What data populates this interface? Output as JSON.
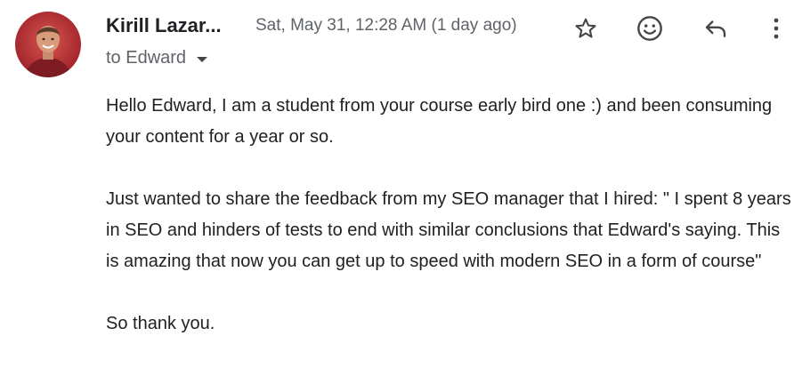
{
  "email": {
    "sender": {
      "name": "Kirill Lazar...",
      "avatar_alt": "avatar"
    },
    "date": "Sat, May 31, 12:28 AM (1 day ago)",
    "recipient_label": "to Edward",
    "actions": {
      "star": "star-icon",
      "emoji": "emoji-icon",
      "reply": "reply-icon",
      "more": "more-vert-icon"
    },
    "body": {
      "paragraphs": [
        "Hello Edward, I am a student from your course early bird one :) and been consuming your content for a year or so.",
        "Just wanted to share the feedback from my SEO manager that I hired: \" I spent 8 years in SEO and hinders of tests to end with similar conclusions that Edward's saying. This is amazing that now you can get up to speed with modern SEO in a form of course\"",
        "So thank you."
      ]
    }
  },
  "colors": {
    "text": "#202124",
    "secondary": "#5f6368",
    "icon": "#444746"
  }
}
